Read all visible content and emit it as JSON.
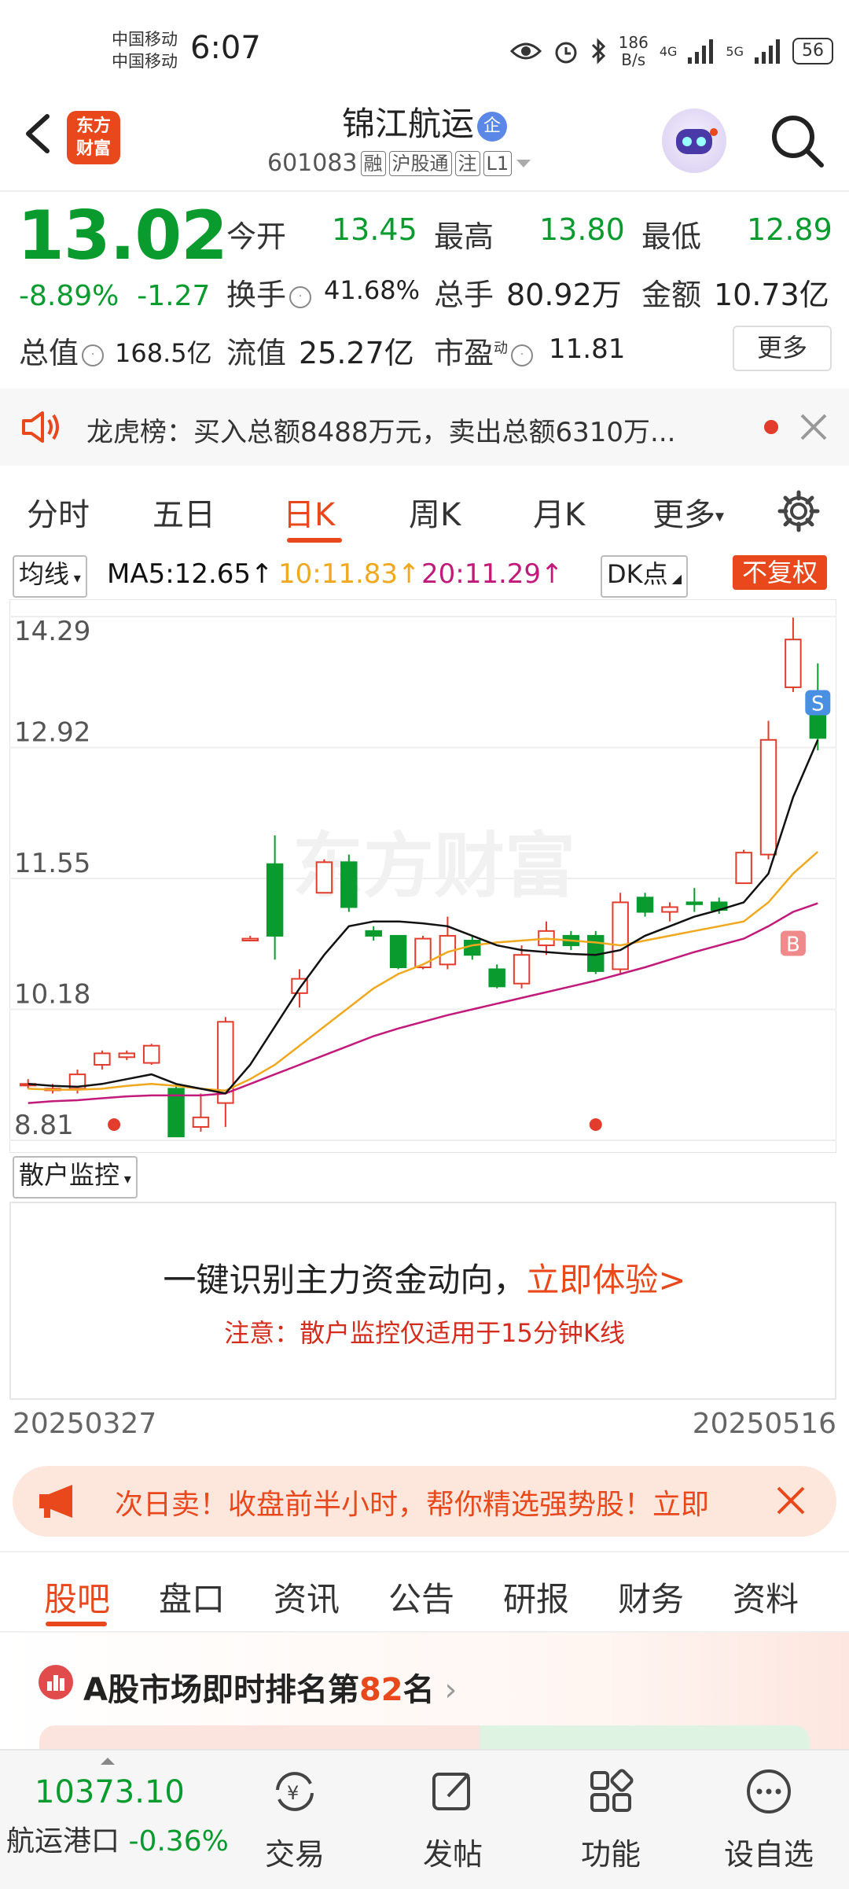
{
  "status_bar": {
    "carrier1": "中国移动",
    "carrier2": "中国移动",
    "time": "6:07",
    "net_speed": "186",
    "net_unit": "B/s",
    "net_type1": "4G",
    "net_type2": "5G",
    "battery": "56"
  },
  "header": {
    "app_logo_line1": "东方",
    "app_logo_line2": "财富",
    "stock_name": "锦江航运",
    "name_badge": "企",
    "stock_code": "601083",
    "tags": [
      "融",
      "沪股通",
      "注",
      "L1"
    ]
  },
  "quote": {
    "price": "13.02",
    "change_pct": "-8.89%",
    "change_amt": "-1.27",
    "fields": {
      "open_label": "今开",
      "open": "13.45",
      "high_label": "最高",
      "high": "13.80",
      "low_label": "最低",
      "low": "12.89",
      "turnover_label": "换手",
      "turnover": "41.68%",
      "volume_label": "总手",
      "volume": "80.92万",
      "amount_label": "金额",
      "amount": "10.73亿",
      "mktcap_label": "总值",
      "mktcap": "168.5亿",
      "float_label": "流值",
      "float": "25.27亿",
      "pe_label": "市盈",
      "pe_sup": "动",
      "pe": "11.81"
    },
    "more_button": "更多"
  },
  "notice": {
    "text": "龙虎榜：买入总额8488万元，卖出总额6310万..."
  },
  "chart_tabs": [
    "分时",
    "五日",
    "日K",
    "周K",
    "月K",
    "更多"
  ],
  "ma": {
    "selector": "均线",
    "ma5_label": "MA5:12.65↑",
    "ma10_label": "10:11.83↑",
    "ma20_label": "20:11.29↑",
    "dk": "DK点",
    "adjust": "不复权",
    "colors": {
      "ma5": "#111111",
      "ma10": "#f0a81e",
      "ma20": "#c21a7a",
      "up": "#e23c2c",
      "down": "#0a9b2f"
    }
  },
  "chart_data": {
    "type": "candlestick",
    "y_tick_labels": [
      "14.29",
      "12.92",
      "11.55",
      "10.18",
      "8.81"
    ],
    "ylim": [
      8.81,
      14.29
    ],
    "grid": true,
    "watermark": "东方财富",
    "markers": {
      "sell": "S",
      "buy": "B"
    },
    "candles": [
      {
        "o": 9.4,
        "h": 9.45,
        "l": 9.35,
        "c": 9.4
      },
      {
        "o": 9.35,
        "h": 9.4,
        "l": 9.3,
        "c": 9.35
      },
      {
        "o": 9.35,
        "h": 9.55,
        "l": 9.3,
        "c": 9.5
      },
      {
        "o": 9.6,
        "h": 9.75,
        "l": 9.55,
        "c": 9.72
      },
      {
        "o": 9.68,
        "h": 9.75,
        "l": 9.65,
        "c": 9.72
      },
      {
        "o": 9.62,
        "h": 9.82,
        "l": 9.6,
        "c": 9.8
      },
      {
        "o": 9.35,
        "h": 9.4,
        "l": 8.85,
        "c": 8.85
      },
      {
        "o": 8.95,
        "h": 9.3,
        "l": 8.9,
        "c": 9.05
      },
      {
        "o": 9.2,
        "h": 10.1,
        "l": 8.95,
        "c": 10.05
      },
      {
        "o": 10.9,
        "h": 10.95,
        "l": 10.9,
        "c": 10.92
      },
      {
        "o": 11.7,
        "h": 12.0,
        "l": 10.7,
        "c": 10.95
      },
      {
        "o": 10.35,
        "h": 10.6,
        "l": 10.2,
        "c": 10.5
      },
      {
        "o": 11.4,
        "h": 11.75,
        "l": 11.4,
        "c": 11.72
      },
      {
        "o": 11.72,
        "h": 11.8,
        "l": 11.2,
        "c": 11.25
      },
      {
        "o": 11.0,
        "h": 11.05,
        "l": 10.9,
        "c": 10.95
      },
      {
        "o": 10.95,
        "h": 10.95,
        "l": 10.6,
        "c": 10.62
      },
      {
        "o": 10.62,
        "h": 10.95,
        "l": 10.6,
        "c": 10.92
      },
      {
        "o": 10.65,
        "h": 11.15,
        "l": 10.6,
        "c": 10.95
      },
      {
        "o": 10.9,
        "h": 10.95,
        "l": 10.7,
        "c": 10.75
      },
      {
        "o": 10.6,
        "h": 10.65,
        "l": 10.4,
        "c": 10.42
      },
      {
        "o": 10.45,
        "h": 10.85,
        "l": 10.4,
        "c": 10.75
      },
      {
        "o": 10.85,
        "h": 11.1,
        "l": 10.75,
        "c": 11.0
      },
      {
        "o": 10.95,
        "h": 11.0,
        "l": 10.8,
        "c": 10.85
      },
      {
        "o": 10.95,
        "h": 11.0,
        "l": 10.55,
        "c": 10.58
      },
      {
        "o": 10.6,
        "h": 11.4,
        "l": 10.55,
        "c": 11.3
      },
      {
        "o": 11.35,
        "h": 11.4,
        "l": 11.15,
        "c": 11.2
      },
      {
        "o": 11.2,
        "h": 11.3,
        "l": 11.1,
        "c": 11.25
      },
      {
        "o": 11.3,
        "h": 11.45,
        "l": 11.2,
        "c": 11.28
      },
      {
        "o": 11.3,
        "h": 11.35,
        "l": 11.18,
        "c": 11.22
      },
      {
        "o": 11.5,
        "h": 11.85,
        "l": 11.5,
        "c": 11.82
      },
      {
        "o": 11.8,
        "h": 13.2,
        "l": 11.75,
        "c": 13.0
      },
      {
        "o": 13.55,
        "h": 14.28,
        "l": 13.5,
        "c": 14.05
      },
      {
        "o": 13.45,
        "h": 13.8,
        "l": 12.89,
        "c": 13.02
      }
    ],
    "ma5": [
      9.4,
      9.38,
      9.37,
      9.4,
      9.45,
      9.5,
      9.4,
      9.35,
      9.3,
      9.6,
      10.0,
      10.4,
      10.75,
      11.05,
      11.1,
      11.1,
      11.08,
      11.05,
      10.95,
      10.85,
      10.8,
      10.78,
      10.76,
      10.75,
      10.8,
      10.95,
      11.05,
      11.15,
      11.22,
      11.3,
      11.6,
      12.4,
      13.0
    ],
    "ma10": [
      9.35,
      9.34,
      9.34,
      9.35,
      9.38,
      9.4,
      9.38,
      9.35,
      9.33,
      9.45,
      9.6,
      9.8,
      10.0,
      10.2,
      10.4,
      10.55,
      10.65,
      10.78,
      10.85,
      10.88,
      10.9,
      10.92,
      10.9,
      10.88,
      10.85,
      10.9,
      10.95,
      11.0,
      11.05,
      11.1,
      11.3,
      11.6,
      11.83
    ],
    "ma20": [
      9.2,
      9.22,
      9.23,
      9.25,
      9.27,
      9.28,
      9.28,
      9.28,
      9.3,
      9.4,
      9.5,
      9.6,
      9.7,
      9.8,
      9.9,
      9.98,
      10.05,
      10.12,
      10.18,
      10.24,
      10.3,
      10.36,
      10.42,
      10.48,
      10.55,
      10.62,
      10.7,
      10.78,
      10.85,
      10.92,
      11.05,
      11.2,
      11.29
    ]
  },
  "monitor": {
    "selector": "散户监控",
    "main_text": "一键识别主力资金动向，",
    "link": "立即体验>",
    "note": "注意：散户监控仅适用于15分钟K线"
  },
  "dates": {
    "start": "20250327",
    "end": "20250516"
  },
  "promo": {
    "text": "次日卖！收盘前半小时，帮你精选强势股！立即"
  },
  "bottom_tabs": [
    "股吧",
    "盘口",
    "资讯",
    "公告",
    "研报",
    "财务",
    "资料"
  ],
  "rank": {
    "prefix": "A股市场即时排名第",
    "number": "82",
    "suffix": "名"
  },
  "bottom_nav": {
    "index_value": "10373.10",
    "index_name": "航运港口",
    "index_change": "-0.36%",
    "items": [
      "交易",
      "发帖",
      "功能",
      "设自选"
    ]
  }
}
